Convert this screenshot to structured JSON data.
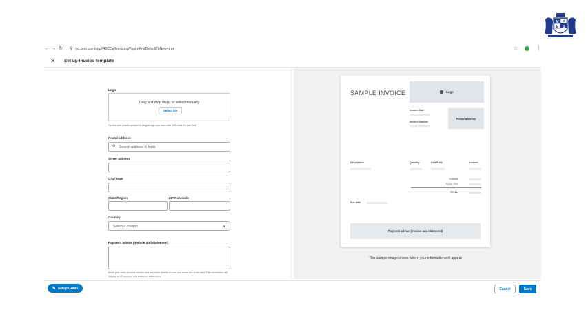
{
  "browser": {
    "url": "go.xero.com/app/!4SCDq/invoicing/?optInAndDefaultToNew=true"
  },
  "header": {
    "title": "Set up invoice template",
    "close_glyph": "✕"
  },
  "form": {
    "logo_label": "Logo",
    "dropzone_text": "Drag and drop file(s) or select manually",
    "select_file_label": "Select file",
    "logo_hint": "For the best results upload the largest logo you have with 1MB total file size limit",
    "postal_label": "Postal address",
    "postal_placeholder": "Search address in India",
    "street_label": "Street address",
    "city_label": "City/Town",
    "state_label": "State/Region",
    "zip_label": "ZIP/Postcode",
    "country_label": "Country",
    "country_placeholder": "Select a country",
    "payment_label": "Payment advice (Invoice and statement)",
    "payment_hint": "Enter your bank account number and any other details on how you would like to be paid. This information will display on all invoices and customer statements."
  },
  "preview": {
    "sample_title": "SAMPLE INVOICE",
    "logo_label": "Logo",
    "invoice_date_label": "Invoice Date",
    "invoice_number_label": "Invoice Number",
    "postal_address_label": "Postal address",
    "columns": [
      "Description",
      "Quantity",
      "Unit Price",
      "Amount"
    ],
    "subtotal_label": "Subtotal",
    "tax_label": "TOTAL TAX",
    "total_label": "TOTAL",
    "due_date_label": "Due date",
    "payment_advice_label": "Payment advice (Invoice and statement)",
    "caption": "This sample image shows where your information will appear"
  },
  "footer": {
    "setup_guide_label": "Setup Guide",
    "cancel_label": "Cancel",
    "save_label": "Save"
  },
  "colors": {
    "accent": "#0078c8",
    "panel_bg": "#eff1f3"
  },
  "icons": [
    "back-icon",
    "forward-icon",
    "reload-icon",
    "tune-icon",
    "star-icon",
    "extension-icon",
    "kebab-icon",
    "close-icon",
    "search-icon",
    "chevron-down-icon",
    "image-icon",
    "setup-guide-icon"
  ]
}
